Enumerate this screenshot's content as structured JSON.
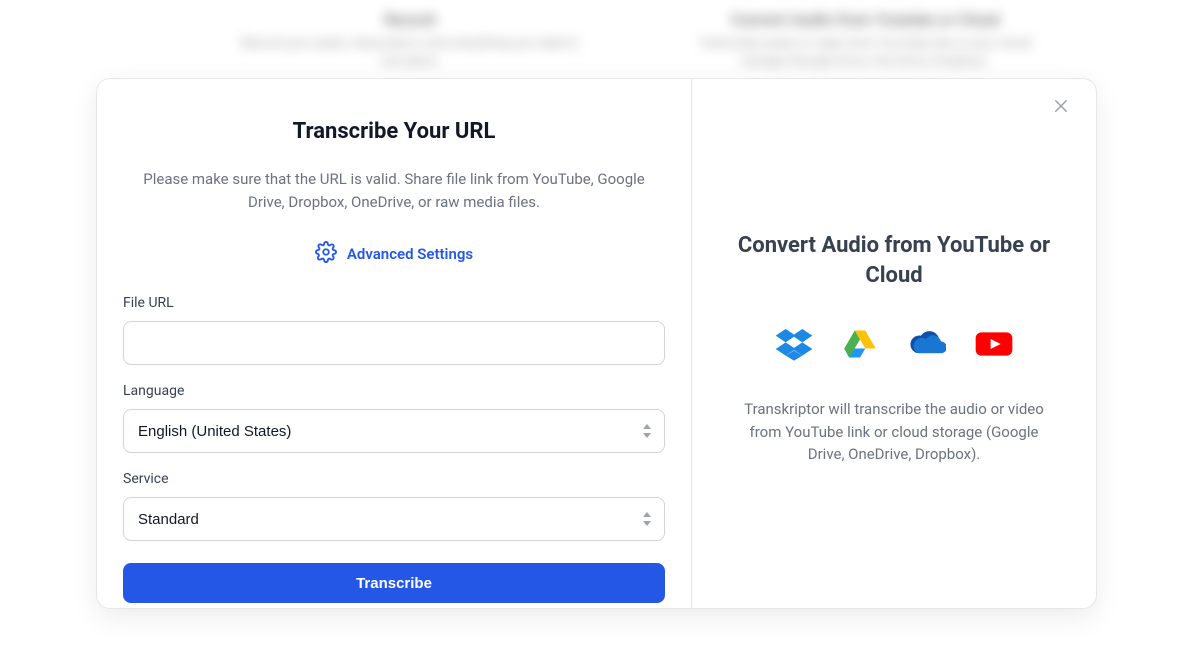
{
  "left": {
    "title": "Transcribe Your URL",
    "description": "Please make sure that the URL is valid. Share file link from YouTube, Google Drive, Dropbox, OneDrive, or raw media files.",
    "advanced_label": "Advanced Settings",
    "file_url_label": "File URL",
    "file_url_value": "",
    "language_label": "Language",
    "language_value": "English (United States)",
    "service_label": "Service",
    "service_value": "Standard",
    "submit_label": "Transcribe"
  },
  "right": {
    "title": "Convert Audio from YouTube or Cloud",
    "description": "Transkriptor will transcribe the audio or video from YouTube link or cloud storage (Google Drive, OneDrive, Dropbox).",
    "services": [
      "Dropbox",
      "Google Drive",
      "OneDrive",
      "YouTube"
    ]
  },
  "background": {
    "col_b_title": "Record",
    "col_b_sub": "Record your audio, transcribe it, and everything you need in one place.",
    "col_c_title": "Convert Audio from Youtube or Cloud",
    "col_c_sub": "Transcribe audio or video from YouTube link or your cloud storage (Google Drive, One Drive, Dropbox)."
  }
}
